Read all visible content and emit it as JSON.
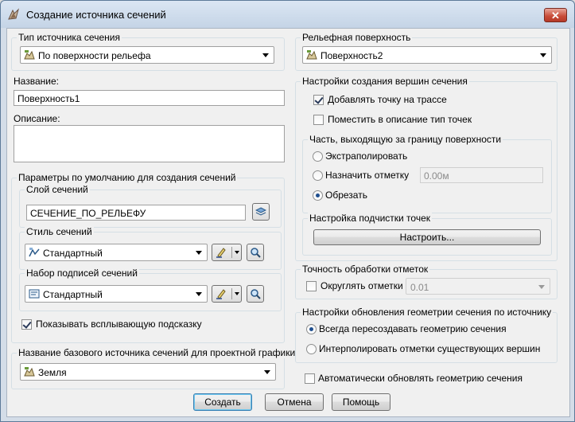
{
  "window": {
    "title": "Создание источника сечений",
    "close_glyph": "✕"
  },
  "left": {
    "source_type_label": "Тип источника сечения",
    "source_type_value": "По поверхности рельефа",
    "name_label": "Название:",
    "name_value": "Поверхность1",
    "description_label": "Описание:",
    "description_value": "",
    "defaults_group": "Параметры по умолчанию для создания сечений",
    "layer_label": "Слой сечений",
    "layer_value": "СЕЧЕНИЕ_ПО_РЕЛЬЕФУ",
    "style_label": "Стиль сечений",
    "style_value": "Стандартный",
    "labelset_label": "Набор подписей сечений",
    "labelset_value": "Стандартный",
    "tooltip_label": "Показывать всплывающую подсказку",
    "tooltip_checked": true,
    "base_source_label": "Название базового источника сечений для проектной графики",
    "base_source_value": "Земля"
  },
  "right": {
    "surface_label": "Рельефная поверхность",
    "surface_value": "Поверхность2",
    "vertex_group": "Настройки создания вершин сечения",
    "add_point_label": "Добавлять точку на трассе",
    "add_point_checked": true,
    "point_type_label": "Поместить в описание тип точек",
    "point_type_checked": false,
    "outside_group": "Часть, выходящую за границу поверхности",
    "extrapolate_label": "Экстраполировать",
    "assign_elev_label": "Назначить отметку",
    "assign_elev_value": "0.00м",
    "trim_label": "Обрезать",
    "outside_selected": "trim",
    "cleanup_group": "Настройка подчистки точек",
    "configure_label": "Настроить...",
    "precision_group": "Точность обработки отметок",
    "round_label": "Округлять отметки",
    "round_checked": false,
    "round_value": "0.01",
    "update_group": "Настройки обновления геометрии сечения по источнику",
    "rebuild_label": "Всегда пересоздавать геометрию сечения",
    "interpolate_label": "Интерполировать отметки существующих вершин",
    "update_selected": "rebuild",
    "auto_update_label": "Автоматически обновлять геометрию сечения",
    "auto_update_checked": false
  },
  "footer": {
    "create_label": "Создать",
    "cancel_label": "Отмена",
    "help_label": "Помощь"
  },
  "icons": [
    "app-icon",
    "surface-icon",
    "layer-icon",
    "style-icon",
    "labelset-icon",
    "edit-icon",
    "magnify-icon"
  ]
}
